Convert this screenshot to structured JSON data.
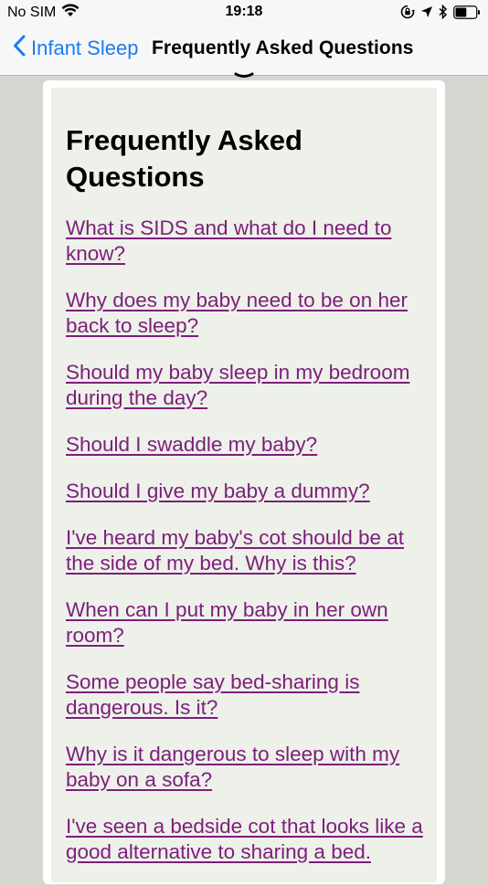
{
  "status_bar": {
    "carrier": "No SIM",
    "time": "19:18",
    "icons": [
      "wifi-icon",
      "screen-rotation-lock-icon",
      "location-arrow-icon",
      "bluetooth-icon",
      "battery-icon"
    ],
    "battery_level": 0.55
  },
  "nav": {
    "back_label": "Infant Sleep",
    "title": "Frequently Asked Questions"
  },
  "colors": {
    "accent": "#1a7cf0",
    "link": "#7b1f7a",
    "card_bg": "#eef0ea",
    "page_bg": "#d4d6cf"
  },
  "content": {
    "heading": "Frequently Asked Questions",
    "faqs": [
      "What is SIDS and what do I need to know?",
      "Why does my baby need to be on her back to sleep?",
      "Should my baby sleep in my bedroom during the day?",
      "Should I swaddle my baby?",
      "Should I give my baby a dummy?",
      "I've heard my baby's cot should be at the side of my bed. Why is this?",
      "When can I put my baby in her own room?",
      "Some people say bed-sharing is dangerous. Is it?",
      "Why is it dangerous to sleep with my baby on a sofa?",
      "I've seen a bedside cot that looks like a good alternative to sharing a bed."
    ]
  }
}
